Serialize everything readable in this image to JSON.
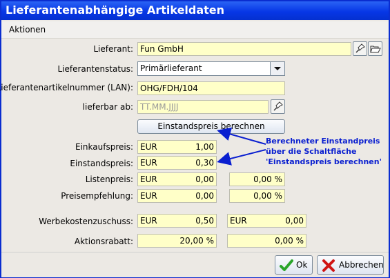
{
  "window": {
    "title": "Lieferantenabhängige Artikeldaten"
  },
  "menu": {
    "aktionen": "Aktionen"
  },
  "labels": {
    "lieferant": "Lieferant:",
    "status": "Lieferantenstatus:",
    "lan": "Lieferantenartikelnummer (LAN):",
    "lieferbar": "lieferbar ab:",
    "einkaufspreis": "Einkaufspreis:",
    "einstandspreis": "Einstandspreis:",
    "listenpreis": "Listenpreis:",
    "preisempfehlung": "Preisempfehlung:",
    "werbekosten": "Werbekostenzuschuss:",
    "aktionsrabatt": "Aktionsrabatt:"
  },
  "fields": {
    "lieferant": "Fun GmbH",
    "status": "Primärlieferant",
    "lan": "OHG/FDH/104",
    "lieferbar_placeholder": "TT.MM.JJJJ",
    "einkauf": {
      "currency": "EUR",
      "amount": "1,00"
    },
    "einstand": {
      "currency": "EUR",
      "amount": "0,30"
    },
    "listen": {
      "currency": "EUR",
      "amount": "0,00",
      "percent": "0,00 %"
    },
    "preisempf": {
      "currency": "EUR",
      "amount": "0,00",
      "percent": "0,00 %"
    },
    "werbe": {
      "currency": "EUR",
      "amount": "0,50",
      "currency2": "EUR",
      "amount2": "0,00"
    },
    "aktion": {
      "percent": "20,00 %",
      "percent2": "0,00 %"
    }
  },
  "buttons": {
    "einstandspreis_berechnen": "Einstandspreis berechnen",
    "ok": "Ok",
    "abbrechen": "Abbrechen"
  },
  "annotation": {
    "line1": "Berechneter Einstandpreis",
    "line2": "über die Schaltfläche",
    "line3": "'Einstandspreis berechnen'"
  },
  "icons": {
    "pick": "pushpin-icon",
    "open": "folder-open-icon",
    "ok": "checkmark-icon",
    "cancel": "x-icon"
  },
  "colors": {
    "title_bar": "#0737e6",
    "field_bg": "#ffffc8",
    "annotation": "#0a1fd0"
  }
}
